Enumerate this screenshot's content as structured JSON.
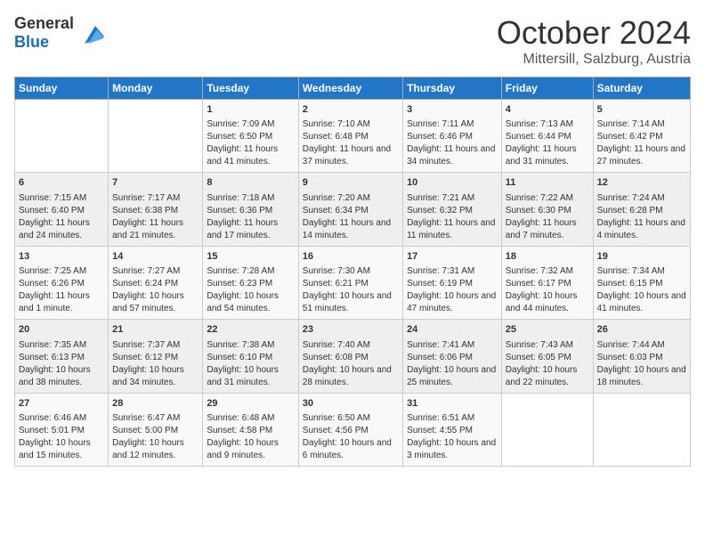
{
  "header": {
    "logo_general": "General",
    "logo_blue": "Blue",
    "month": "October 2024",
    "location": "Mittersill, Salzburg, Austria"
  },
  "days_of_week": [
    "Sunday",
    "Monday",
    "Tuesday",
    "Wednesday",
    "Thursday",
    "Friday",
    "Saturday"
  ],
  "weeks": [
    [
      {
        "day": "",
        "info": ""
      },
      {
        "day": "",
        "info": ""
      },
      {
        "day": "1",
        "info": "Sunrise: 7:09 AM\nSunset: 6:50 PM\nDaylight: 11 hours and 41 minutes."
      },
      {
        "day": "2",
        "info": "Sunrise: 7:10 AM\nSunset: 6:48 PM\nDaylight: 11 hours and 37 minutes."
      },
      {
        "day": "3",
        "info": "Sunrise: 7:11 AM\nSunset: 6:46 PM\nDaylight: 11 hours and 34 minutes."
      },
      {
        "day": "4",
        "info": "Sunrise: 7:13 AM\nSunset: 6:44 PM\nDaylight: 11 hours and 31 minutes."
      },
      {
        "day": "5",
        "info": "Sunrise: 7:14 AM\nSunset: 6:42 PM\nDaylight: 11 hours and 27 minutes."
      }
    ],
    [
      {
        "day": "6",
        "info": "Sunrise: 7:15 AM\nSunset: 6:40 PM\nDaylight: 11 hours and 24 minutes."
      },
      {
        "day": "7",
        "info": "Sunrise: 7:17 AM\nSunset: 6:38 PM\nDaylight: 11 hours and 21 minutes."
      },
      {
        "day": "8",
        "info": "Sunrise: 7:18 AM\nSunset: 6:36 PM\nDaylight: 11 hours and 17 minutes."
      },
      {
        "day": "9",
        "info": "Sunrise: 7:20 AM\nSunset: 6:34 PM\nDaylight: 11 hours and 14 minutes."
      },
      {
        "day": "10",
        "info": "Sunrise: 7:21 AM\nSunset: 6:32 PM\nDaylight: 11 hours and 11 minutes."
      },
      {
        "day": "11",
        "info": "Sunrise: 7:22 AM\nSunset: 6:30 PM\nDaylight: 11 hours and 7 minutes."
      },
      {
        "day": "12",
        "info": "Sunrise: 7:24 AM\nSunset: 6:28 PM\nDaylight: 11 hours and 4 minutes."
      }
    ],
    [
      {
        "day": "13",
        "info": "Sunrise: 7:25 AM\nSunset: 6:26 PM\nDaylight: 11 hours and 1 minute."
      },
      {
        "day": "14",
        "info": "Sunrise: 7:27 AM\nSunset: 6:24 PM\nDaylight: 10 hours and 57 minutes."
      },
      {
        "day": "15",
        "info": "Sunrise: 7:28 AM\nSunset: 6:23 PM\nDaylight: 10 hours and 54 minutes."
      },
      {
        "day": "16",
        "info": "Sunrise: 7:30 AM\nSunset: 6:21 PM\nDaylight: 10 hours and 51 minutes."
      },
      {
        "day": "17",
        "info": "Sunrise: 7:31 AM\nSunset: 6:19 PM\nDaylight: 10 hours and 47 minutes."
      },
      {
        "day": "18",
        "info": "Sunrise: 7:32 AM\nSunset: 6:17 PM\nDaylight: 10 hours and 44 minutes."
      },
      {
        "day": "19",
        "info": "Sunrise: 7:34 AM\nSunset: 6:15 PM\nDaylight: 10 hours and 41 minutes."
      }
    ],
    [
      {
        "day": "20",
        "info": "Sunrise: 7:35 AM\nSunset: 6:13 PM\nDaylight: 10 hours and 38 minutes."
      },
      {
        "day": "21",
        "info": "Sunrise: 7:37 AM\nSunset: 6:12 PM\nDaylight: 10 hours and 34 minutes."
      },
      {
        "day": "22",
        "info": "Sunrise: 7:38 AM\nSunset: 6:10 PM\nDaylight: 10 hours and 31 minutes."
      },
      {
        "day": "23",
        "info": "Sunrise: 7:40 AM\nSunset: 6:08 PM\nDaylight: 10 hours and 28 minutes."
      },
      {
        "day": "24",
        "info": "Sunrise: 7:41 AM\nSunset: 6:06 PM\nDaylight: 10 hours and 25 minutes."
      },
      {
        "day": "25",
        "info": "Sunrise: 7:43 AM\nSunset: 6:05 PM\nDaylight: 10 hours and 22 minutes."
      },
      {
        "day": "26",
        "info": "Sunrise: 7:44 AM\nSunset: 6:03 PM\nDaylight: 10 hours and 18 minutes."
      }
    ],
    [
      {
        "day": "27",
        "info": "Sunrise: 6:46 AM\nSunset: 5:01 PM\nDaylight: 10 hours and 15 minutes."
      },
      {
        "day": "28",
        "info": "Sunrise: 6:47 AM\nSunset: 5:00 PM\nDaylight: 10 hours and 12 minutes."
      },
      {
        "day": "29",
        "info": "Sunrise: 6:48 AM\nSunset: 4:58 PM\nDaylight: 10 hours and 9 minutes."
      },
      {
        "day": "30",
        "info": "Sunrise: 6:50 AM\nSunset: 4:56 PM\nDaylight: 10 hours and 6 minutes."
      },
      {
        "day": "31",
        "info": "Sunrise: 6:51 AM\nSunset: 4:55 PM\nDaylight: 10 hours and 3 minutes."
      },
      {
        "day": "",
        "info": ""
      },
      {
        "day": "",
        "info": ""
      }
    ]
  ]
}
